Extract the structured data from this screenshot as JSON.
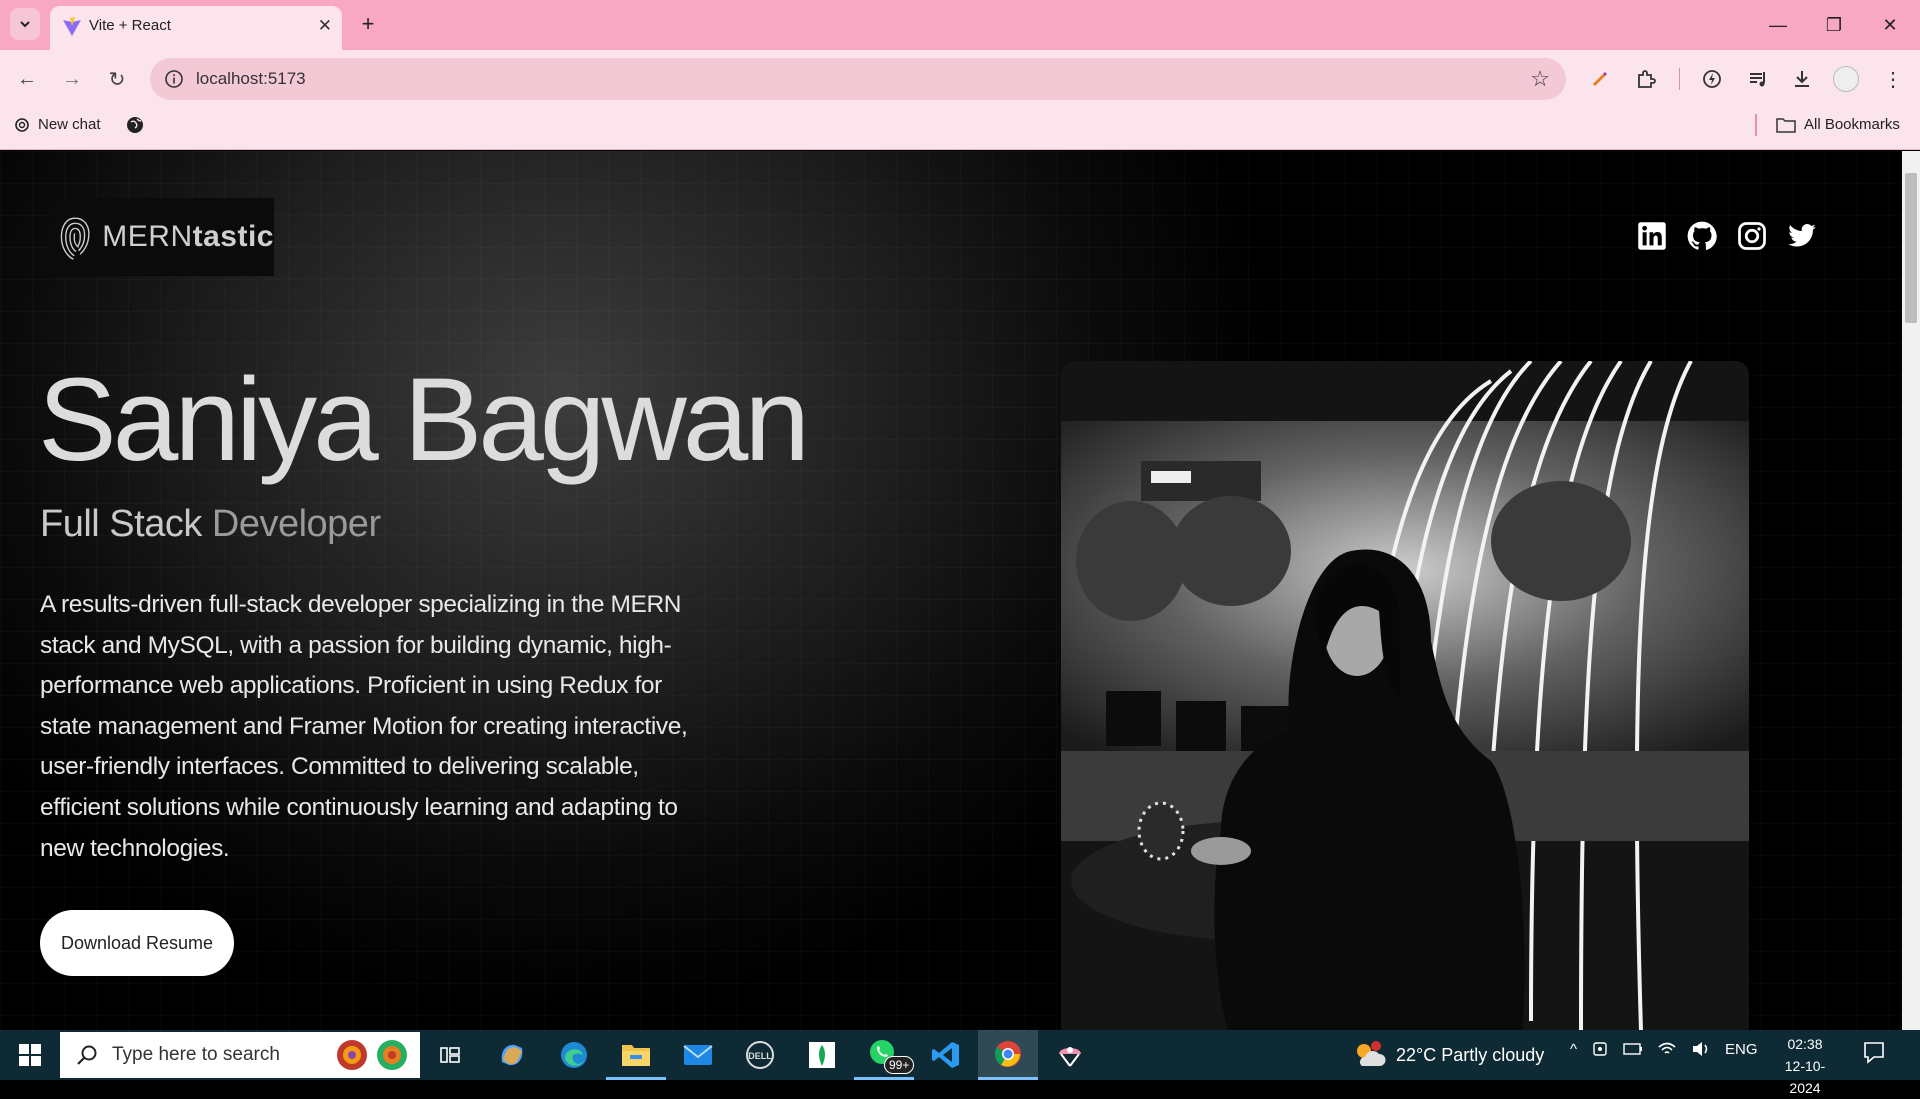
{
  "browser": {
    "tab_title": "Vite + React",
    "url": "localhost:5173",
    "bookmarks": [
      {
        "label": "New chat"
      }
    ],
    "all_bookmarks_label": "All Bookmarks"
  },
  "site": {
    "logo_text_light": "MERN",
    "logo_text_bold": "tastic",
    "socials": [
      "linkedin-icon",
      "github-icon",
      "instagram-icon",
      "twitter-icon"
    ],
    "name": "Saniya Bagwan",
    "role_part1": "Full Stack ",
    "role_part2": "Developer",
    "bio": "A results-driven full-stack developer specializing in the MERN stack and MySQL, with a passion for building dynamic, high-performance web applications. Proficient in using Redux for state management and Framer Motion for creating interactive, user-friendly interfaces. Committed to delivering scalable, efficient solutions while continuously learning and adapting to new technologies.",
    "download_label": "Download Resume"
  },
  "taskbar": {
    "search_placeholder": "Type here to search",
    "whatsapp_badge": "99+",
    "weather": "22°C  Partly cloudy",
    "lang": "ENG",
    "time": "02:38",
    "date": "12-10-2024"
  },
  "colors": {
    "tab_strip": "#f9a8c3",
    "toolbar": "#fce4ec",
    "page_bg": "#000000",
    "taskbar": "#0e2a35"
  }
}
